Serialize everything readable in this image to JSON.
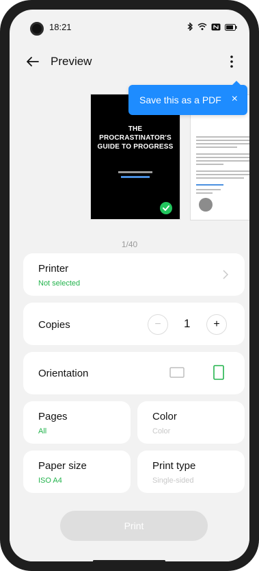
{
  "status": {
    "time": "18:21"
  },
  "header": {
    "title": "Preview"
  },
  "tooltip": {
    "text": "Save this as a PDF",
    "close": "×"
  },
  "preview": {
    "book_title": "THE PROCRASTINATOR'S GUIDE TO PROGRESS",
    "page_counter": "1/40"
  },
  "printer": {
    "label": "Printer",
    "value": "Not selected"
  },
  "copies": {
    "label": "Copies",
    "value": "1",
    "minus": "−",
    "plus": "+"
  },
  "orientation": {
    "label": "Orientation",
    "selected": "portrait"
  },
  "pages": {
    "label": "Pages",
    "value": "All"
  },
  "color": {
    "label": "Color",
    "value": "Color"
  },
  "paper_size": {
    "label": "Paper size",
    "value": "ISO A4"
  },
  "print_type": {
    "label": "Print type",
    "value": "Single-sided"
  },
  "print_button": {
    "label": "Print"
  },
  "colors": {
    "accent_green": "#22b34c",
    "tooltip_blue": "#1e8cff"
  }
}
